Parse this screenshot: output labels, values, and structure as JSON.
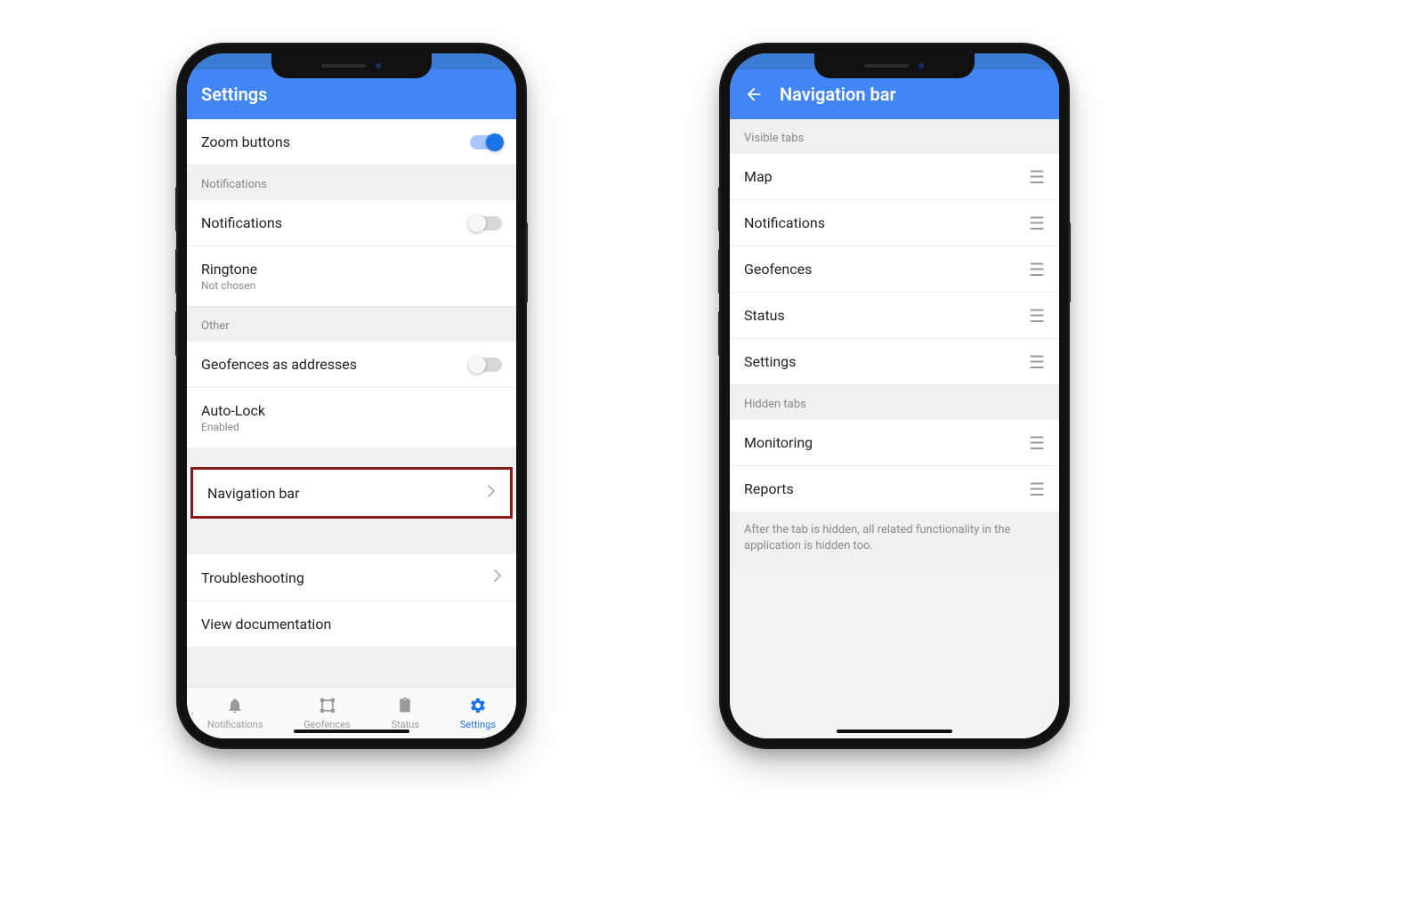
{
  "phone1": {
    "title": "Settings",
    "rows": {
      "zoom": "Zoom buttons",
      "notifications_header": "Notifications",
      "notifications": "Notifications",
      "ringtone": "Ringtone",
      "ringtone_sub": "Not chosen",
      "other_header": "Other",
      "geofences_addr": "Geofences as addresses",
      "autolock": "Auto-Lock",
      "autolock_sub": "Enabled",
      "navbar": "Navigation bar",
      "troubleshooting": "Troubleshooting",
      "viewdocs": "View documentation"
    },
    "bottomnav": {
      "notifications": "Notifications",
      "geofences": "Geofences",
      "status": "Status",
      "settings": "Settings"
    }
  },
  "phone2": {
    "title": "Navigation bar",
    "visible_header": "Visible tabs",
    "hidden_header": "Hidden tabs",
    "tabs": {
      "map": "Map",
      "notifications": "Notifications",
      "geofences": "Geofences",
      "status": "Status",
      "settings": "Settings",
      "monitoring": "Monitoring",
      "reports": "Reports"
    },
    "footer": "After the tab is hidden, all related functionality in the application is hidden too."
  }
}
